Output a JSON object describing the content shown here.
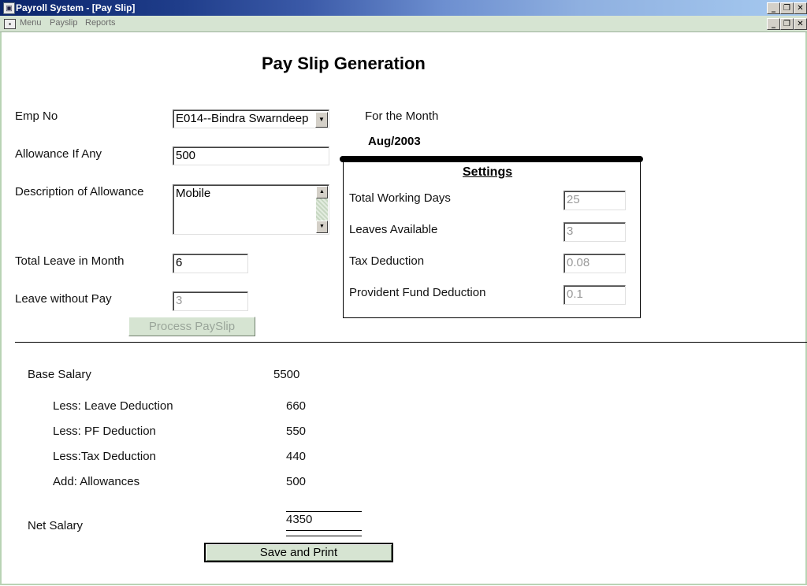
{
  "window": {
    "icon": "app-window-icon",
    "title": "Payroll System - [Pay Slip]",
    "buttons": {
      "minimize": "_",
      "restore": "❐",
      "close": "✕"
    }
  },
  "menu": [
    "Menu",
    "Payslip",
    "Reports"
  ],
  "page_title": "Pay Slip Generation",
  "form": {
    "emp_no_label": "Emp No",
    "emp_no_value": "E014--Bindra Swarndeep",
    "allowance_label": "Allowance If Any",
    "allowance_value": "500",
    "description_label": "Description of Allowance",
    "description_value": "Mobile",
    "total_leave_label": "Total Leave in Month",
    "total_leave_value": "6",
    "leave_without_pay_label": "Leave without Pay",
    "leave_without_pay_value": "3",
    "process_button": "Process PaySlip"
  },
  "month": {
    "label": "For the Month",
    "value": "Aug/2003"
  },
  "settings": {
    "title": "Settings",
    "items": [
      {
        "label": "Total Working Days",
        "value": "25"
      },
      {
        "label": "Leaves Available",
        "value": "3"
      },
      {
        "label": "Tax Deduction",
        "value": "0.08"
      },
      {
        "label": "Provident Fund Deduction",
        "value": "0.1"
      }
    ]
  },
  "salary": {
    "base_label": "Base Salary",
    "base_value": "5500",
    "lines": [
      {
        "label": "Less: Leave Deduction",
        "value": "660"
      },
      {
        "label": "Less: PF Deduction",
        "value": "550"
      },
      {
        "label": "Less:Tax Deduction",
        "value": "440"
      },
      {
        "label": "Add: Allowances",
        "value": "500"
      }
    ],
    "net_label": "Net Salary",
    "net_value": "4350"
  },
  "save_button": "Save and Print",
  "colors": {
    "titlebar_start": "#0a246a",
    "titlebar_end": "#a6caf0",
    "menubar": "#d6e4d2",
    "button_face": "#d6e4d2"
  }
}
